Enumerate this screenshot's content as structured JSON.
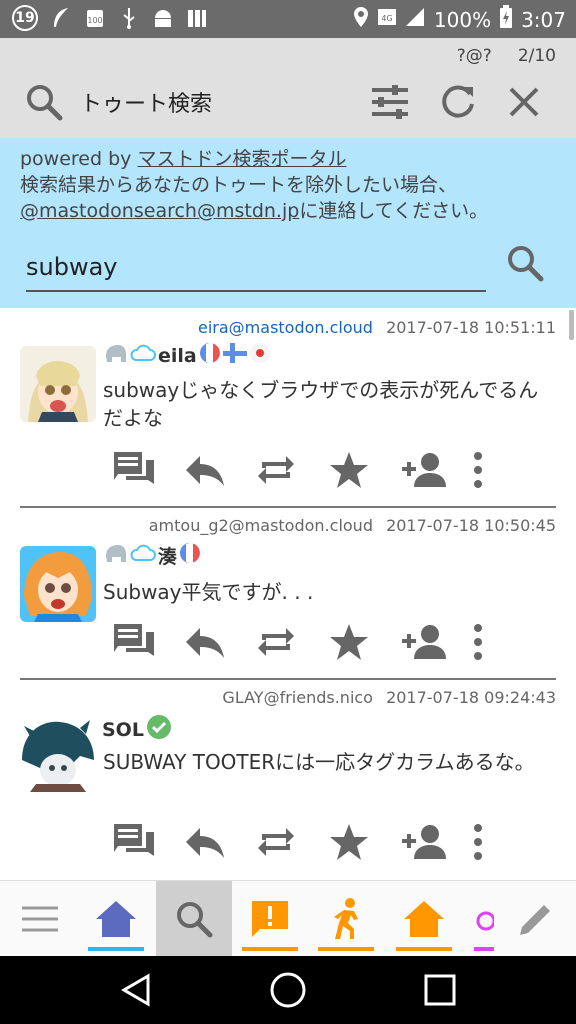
{
  "status_bar": {
    "notif_count": "19",
    "battery": "100%",
    "time": "3:07",
    "network": "4G"
  },
  "header": {
    "title": "トゥート検索",
    "unknown_count": "?@?",
    "page_count": "2/10"
  },
  "info": {
    "powered_by_prefix": "powered by ",
    "portal_link": "マストドン検索ポータル",
    "line2": "検索結果からあなたのトゥートを除外したい場合、",
    "contact_link": "@mastodonsearch@mstdn.jp",
    "line3_suffix": "に連絡してください。",
    "search_value": "subway"
  },
  "posts": [
    {
      "acct": "eira@mastodon.cloud",
      "time": "2017-07-18 10:51:11",
      "name": "eila",
      "content": "subwayじゃなくブラウザでの表示が死んでるんだよな"
    },
    {
      "acct": "amtou_g2@mastodon.cloud",
      "time": "2017-07-18 10:50:45",
      "name": "湊",
      "content": "Subway平気ですが. . ."
    },
    {
      "acct": "GLAY@friends.nico",
      "time": "2017-07-18 09:24:43",
      "name": "SOL",
      "content": "SUBWAY TOOTERには一応タグカラムあるな。"
    }
  ],
  "colors": {
    "header_bg": "#e0e0e0",
    "info_bg": "#b3e5fc",
    "icon_gray": "#666666",
    "home_blue": "#5c6bc0",
    "orange": "#ff9800",
    "underline_cyan": "#29b6f6",
    "verified_green": "#4caf50"
  }
}
